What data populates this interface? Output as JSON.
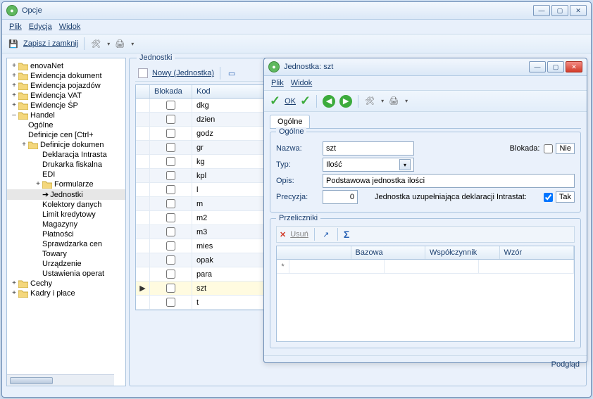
{
  "mainWindow": {
    "title": "Opcje",
    "menu": {
      "file": "Plik",
      "edit": "Edycja",
      "view": "Widok"
    },
    "toolbar": {
      "saveClose": "Zapisz i zamknij"
    }
  },
  "tree": {
    "items": [
      {
        "label": "enovaNet",
        "exp": "+",
        "folder": true,
        "indent": 0
      },
      {
        "label": "Ewidencja dokument",
        "exp": "+",
        "folder": true,
        "indent": 0
      },
      {
        "label": "Ewidencja pojazdów",
        "exp": "+",
        "folder": true,
        "indent": 0
      },
      {
        "label": "Ewidencja VAT",
        "exp": "+",
        "folder": true,
        "indent": 0
      },
      {
        "label": "Ewidencje ŚP",
        "exp": "+",
        "folder": true,
        "indent": 0
      },
      {
        "label": "Handel",
        "exp": "–",
        "folder": true,
        "indent": 0
      },
      {
        "label": "Ogólne",
        "exp": "",
        "folder": false,
        "indent": 1
      },
      {
        "label": "Definicje cen [Ctrl+",
        "exp": "",
        "folder": false,
        "indent": 1
      },
      {
        "label": "Definicje dokumen",
        "exp": "+",
        "folder": true,
        "indent": 1
      },
      {
        "label": "Deklaracja Intrasta",
        "exp": "",
        "folder": false,
        "indent": 2
      },
      {
        "label": "Drukarka fiskalna",
        "exp": "",
        "folder": false,
        "indent": 2
      },
      {
        "label": "EDI",
        "exp": "",
        "folder": false,
        "indent": 2
      },
      {
        "label": "Formularze",
        "exp": "+",
        "folder": true,
        "indent": 2
      },
      {
        "label": "Jednostki",
        "exp": "",
        "folder": false,
        "indent": 2,
        "selected": true,
        "arrow": true
      },
      {
        "label": "Kolektory danych",
        "exp": "",
        "folder": false,
        "indent": 2
      },
      {
        "label": "Limit kredytowy",
        "exp": "",
        "folder": false,
        "indent": 2
      },
      {
        "label": "Magazyny",
        "exp": "",
        "folder": false,
        "indent": 2
      },
      {
        "label": "Płatności",
        "exp": "",
        "folder": false,
        "indent": 2
      },
      {
        "label": "Sprawdzarka cen",
        "exp": "",
        "folder": false,
        "indent": 2
      },
      {
        "label": "Towary",
        "exp": "",
        "folder": false,
        "indent": 2
      },
      {
        "label": "Urządzenie",
        "exp": "",
        "folder": false,
        "indent": 2
      },
      {
        "label": "Ustawienia operat",
        "exp": "",
        "folder": false,
        "indent": 2
      },
      {
        "label": "Cechy",
        "exp": "+",
        "folder": true,
        "indent": 0
      },
      {
        "label": "Kadry i płace",
        "exp": "+",
        "folder": true,
        "indent": 0
      }
    ]
  },
  "listPanel": {
    "title": "Jednostki",
    "newLabel": "Nowy (Jednostka)",
    "columns": {
      "blokada": "Blokada",
      "kod": "Kod"
    },
    "rows": [
      {
        "kod": "dkg"
      },
      {
        "kod": "dzien"
      },
      {
        "kod": "godz"
      },
      {
        "kod": "gr"
      },
      {
        "kod": "kg"
      },
      {
        "kod": "kpl"
      },
      {
        "kod": "l"
      },
      {
        "kod": "m"
      },
      {
        "kod": "m2"
      },
      {
        "kod": "m3"
      },
      {
        "kod": "mies"
      },
      {
        "kod": "opak"
      },
      {
        "kod": "para"
      },
      {
        "kod": "szt",
        "selected": true
      },
      {
        "kod": "t"
      }
    ]
  },
  "subWindow": {
    "title": "Jednostka: szt",
    "menu": {
      "file": "Plik",
      "view": "Widok"
    },
    "okLabel": "OK",
    "tab": "Ogólne",
    "group": "Ogólne",
    "labels": {
      "nazwa": "Nazwa:",
      "blokada": "Blokada:",
      "typ": "Typ:",
      "opis": "Opis:",
      "precyzja": "Precyzja:",
      "intrastat": "Jednostka uzupełniająca deklaracji Intrastat:"
    },
    "values": {
      "nazwa": "szt",
      "typ": "Ilość",
      "opis": "Podstawowa jednostka ilości",
      "precyzja": "0",
      "blokada": "Nie",
      "intrastat": "Tak"
    },
    "przeliczniki": {
      "title": "Przeliczniki",
      "delete": "Usuń",
      "columns": {
        "bazowa": "Bazowa",
        "wsp": "Współczynnik",
        "wzor": "Wzór"
      }
    },
    "footer": {
      "preview": "Podgląd"
    }
  }
}
